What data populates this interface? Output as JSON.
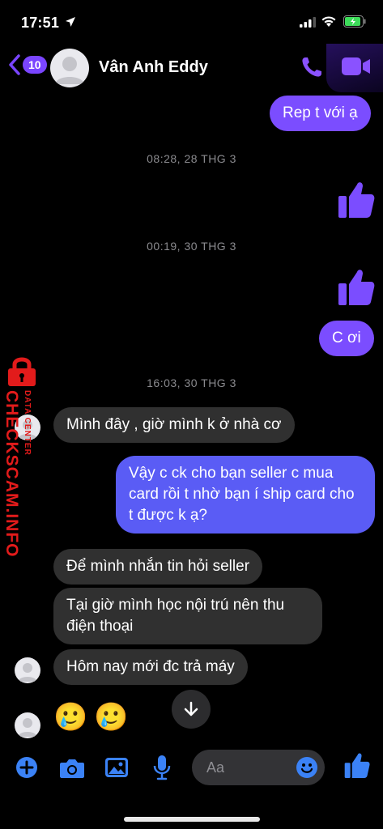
{
  "status_bar": {
    "time": "17:51"
  },
  "header": {
    "back_count": "10",
    "contact_name": "Vân Anh Eddy"
  },
  "colors": {
    "accent": "#7b4dff",
    "accent_blue": "#5a5cf5",
    "incoming": "#303030",
    "icon_blue": "#3b82f6"
  },
  "messages": {
    "m1": "Rep t với ạ",
    "ts1": "08:28, 28 THG 3",
    "ts2": "00:19, 30 THG 3",
    "m2": "C ơi",
    "ts3": "16:03, 30 THG 3",
    "m3": "Mình đây , giờ mình k ở nhà cơ",
    "m4": "Vậy c ck cho bạn seller c mua card rồi t nhờ bạn í ship card cho t được k ạ?",
    "m5": "Để mình nhắn tin hỏi seller",
    "m6": "Tại giờ mình học nội trú nên thu điện thoại",
    "m7": "Hôm nay mới đc trả máy",
    "emoji1": "🥲",
    "emoji2": "🥲"
  },
  "watermark": {
    "line1": "DATA CENTER",
    "line2": "CHECKSCAM.INFO"
  },
  "composer": {
    "placeholder": "Aa"
  },
  "icons": [
    "location-arrow-icon",
    "signal-icon",
    "wifi-icon",
    "battery-icon",
    "back-chevron-icon",
    "phone-icon",
    "video-camera-icon",
    "thumbs-up-icon",
    "lock-icon",
    "chevron-down-icon",
    "plus-icon",
    "camera-icon",
    "image-icon",
    "microphone-icon",
    "smile-icon"
  ]
}
